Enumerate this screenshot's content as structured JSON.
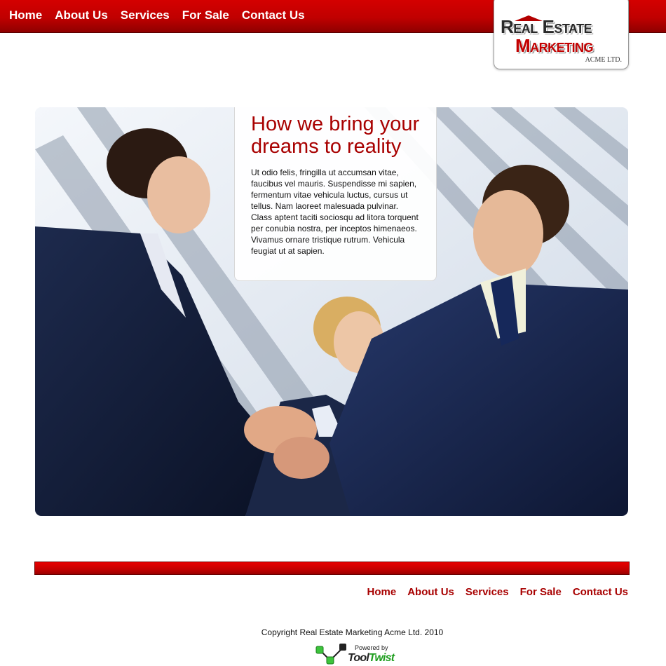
{
  "nav": {
    "items": [
      "Home",
      "About Us",
      "Services",
      "For Sale",
      "Contact Us"
    ]
  },
  "logo": {
    "line1": "Real Estate",
    "line2": "Marketing",
    "line3": "ACME LTD."
  },
  "hero": {
    "title": "How we bring your dreams to reality",
    "text": "Ut odio felis, fringilla ut accumsan vitae, faucibus vel mauris. Suspendisse mi sapien, fermentum vitae vehicula luctus, cursus ut tellus. Nam laoreet malesuada pulvinar. Class aptent taciti sociosqu ad litora torquent per conubia nostra, per inceptos himenaeos. Vivamus ornare tristique rutrum. Vehicula feugiat ut at sapien."
  },
  "footer": {
    "nav": [
      "Home",
      "About Us",
      "Services",
      "For Sale",
      "Contact Us"
    ],
    "copyright": "Copyright Real Estate Marketing Acme Ltd. 2010",
    "powered_label": "Powered by",
    "powered_brand_a": "Tool",
    "powered_brand_b": "Twist"
  },
  "colors": {
    "brand_red": "#c00000",
    "link_red": "#a80000",
    "powered_green": "#1f9e1f"
  },
  "icons": {
    "logo_roof": "roof-icon",
    "powered_logo": "tooltwist-logo-icon"
  }
}
